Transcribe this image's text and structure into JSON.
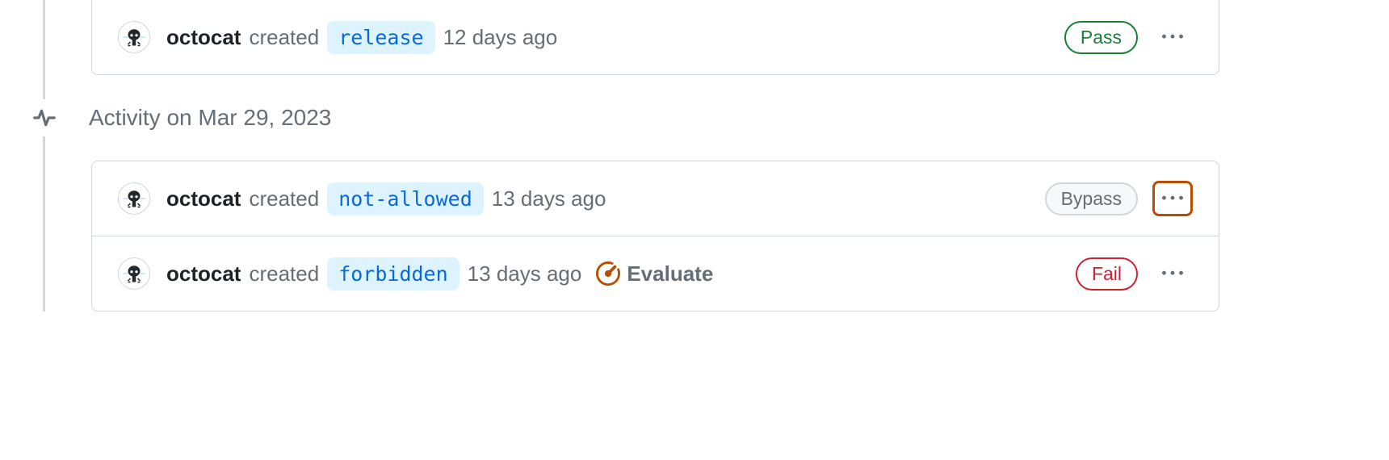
{
  "groups": [
    {
      "items": [
        {
          "username": "octocat",
          "verb": "created",
          "branch": "release",
          "timeago": "12 days ago",
          "status": {
            "type": "pass",
            "label": "Pass"
          },
          "evaluate": false,
          "kebab_highlight": false
        }
      ]
    },
    {
      "date_header": "Activity on Mar 29, 2023",
      "items": [
        {
          "username": "octocat",
          "verb": "created",
          "branch": "not-allowed",
          "timeago": "13 days ago",
          "status": {
            "type": "bypass",
            "label": "Bypass"
          },
          "evaluate": false,
          "kebab_highlight": true
        },
        {
          "username": "octocat",
          "verb": "created",
          "branch": "forbidden",
          "timeago": "13 days ago",
          "status": {
            "type": "fail",
            "label": "Fail"
          },
          "evaluate": true,
          "evaluate_label": "Evaluate",
          "kebab_highlight": false
        }
      ]
    }
  ]
}
